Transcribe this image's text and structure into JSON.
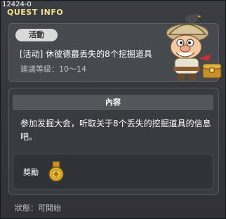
{
  "window": {
    "id_label": "12424-0",
    "title": "QUEST INFO"
  },
  "quest": {
    "tag": "活動",
    "name": "[活动] 休彼德蕞丢失的8个挖掘道具",
    "level": "建議等級：10～14"
  },
  "npc": {
    "icon": "explorer-npc-portrait"
  },
  "content": {
    "header": "內容",
    "text": "参加发掘大会，听取关于8个丢失的挖掘道具的信息吧。"
  },
  "reward": {
    "label": "獎勵",
    "item_icon": "medal-reward-icon"
  },
  "status": "狀態：可開始"
}
